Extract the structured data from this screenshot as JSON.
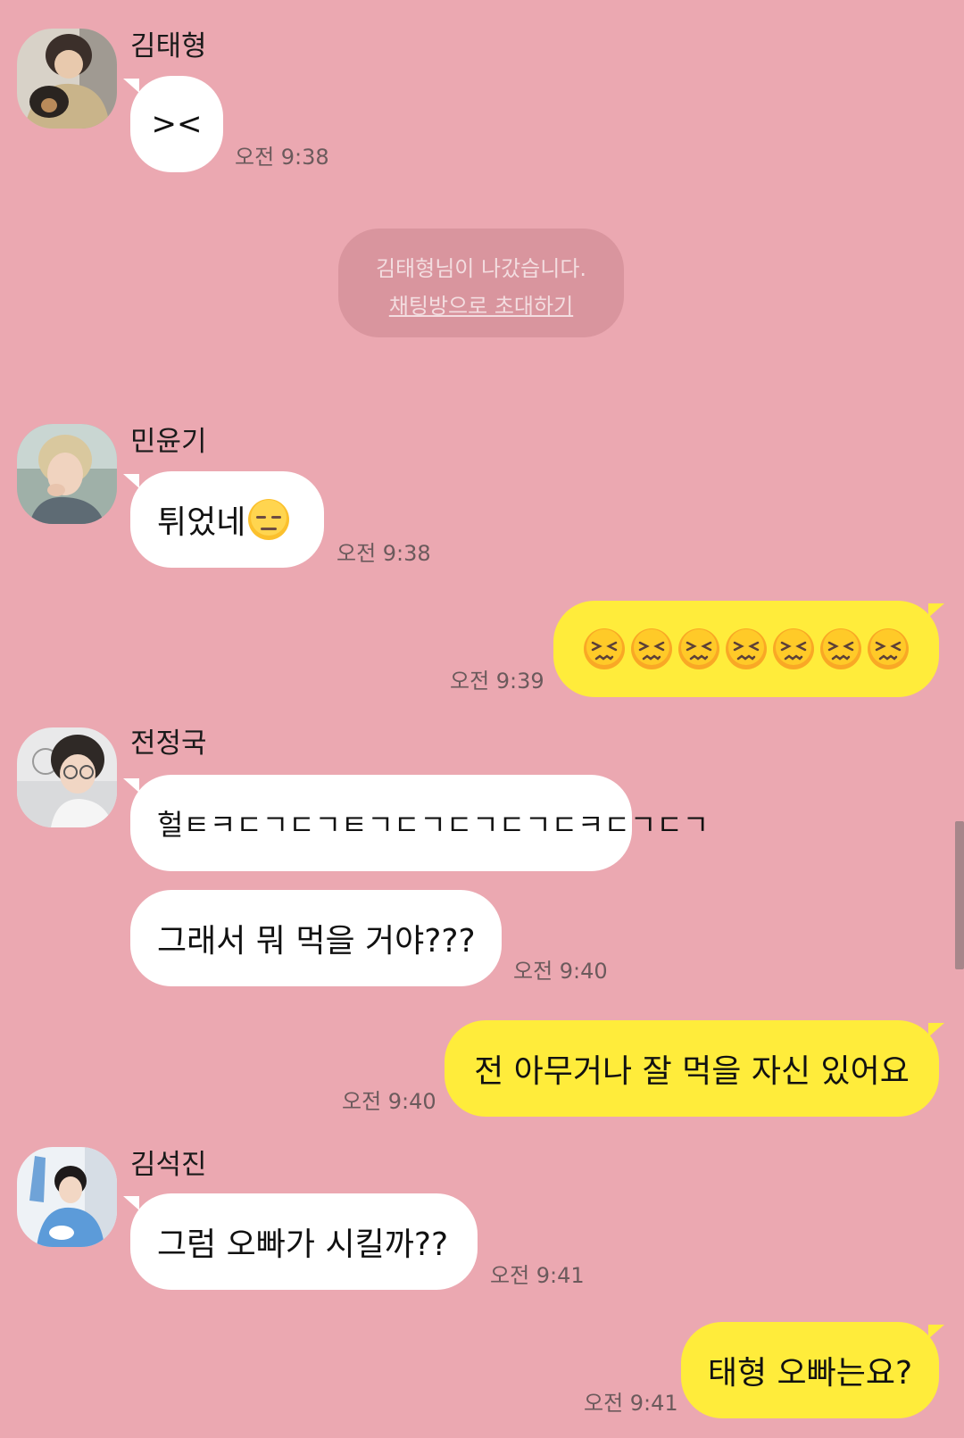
{
  "chat": {
    "group1": {
      "sender": "김태형",
      "message": "><",
      "time": "오전 9:38"
    },
    "system": {
      "left_text": "김태형님이 나갔습니다.",
      "invite_text": "채팅방으로 초대하기"
    },
    "group2": {
      "sender": "민윤기",
      "message": "튀었네",
      "emoji": "expressionless-face-emoji",
      "time": "오전 9:38"
    },
    "out1": {
      "emoji": "persevering-face-emoji",
      "emoji_count": 7,
      "time": "오전 9:39"
    },
    "group3": {
      "sender": "전정국",
      "message1": "헐ㅌㅋㄷㄱㄷㄱㅌㄱㄷㄱㄷㄱㄷㄱㄷㅋㄷㄱㄷㄱ",
      "message2": "그래서 뭐 먹을 거야???",
      "time": "오전 9:40"
    },
    "out2": {
      "message": "전 아무거나 잘 먹을 자신 있어요",
      "time": "오전 9:40"
    },
    "group4": {
      "sender": "김석진",
      "message": "그럼 오빠가 시킬까??",
      "time": "오전 9:41"
    },
    "out3": {
      "message": "태형 오빠는요?",
      "time": "오전 9:41"
    }
  },
  "colors": {
    "background": "#eba8b1",
    "incoming_bubble": "#ffffff",
    "outgoing_bubble": "#ffec3b",
    "system_bubble": "#d9959e"
  }
}
